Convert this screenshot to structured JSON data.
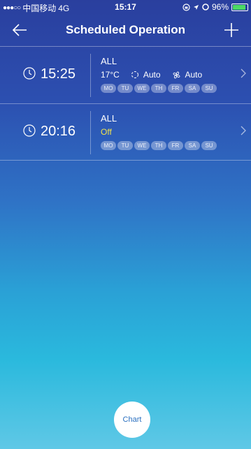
{
  "status_bar": {
    "carrier": "中国移动",
    "network": "4G",
    "time": "15:17",
    "battery": "96%"
  },
  "nav": {
    "title": "Scheduled Operation",
    "back_icon": "arrow-left",
    "add_icon": "plus"
  },
  "schedules": [
    {
      "time": "15:25",
      "target": "ALL",
      "temperature": "17°C",
      "mode": "Auto",
      "fan": "Auto",
      "days": [
        "MO",
        "TU",
        "WE",
        "TH",
        "FR",
        "SA",
        "SU"
      ]
    },
    {
      "time": "20:16",
      "target": "ALL",
      "power": "Off",
      "days": [
        "MO",
        "TU",
        "WE",
        "TH",
        "FR",
        "SA",
        "SU"
      ]
    }
  ],
  "chart_button": {
    "label": "Chart"
  },
  "colors": {
    "off_text": "#f1e34b",
    "battery_green": "#4cd964"
  }
}
